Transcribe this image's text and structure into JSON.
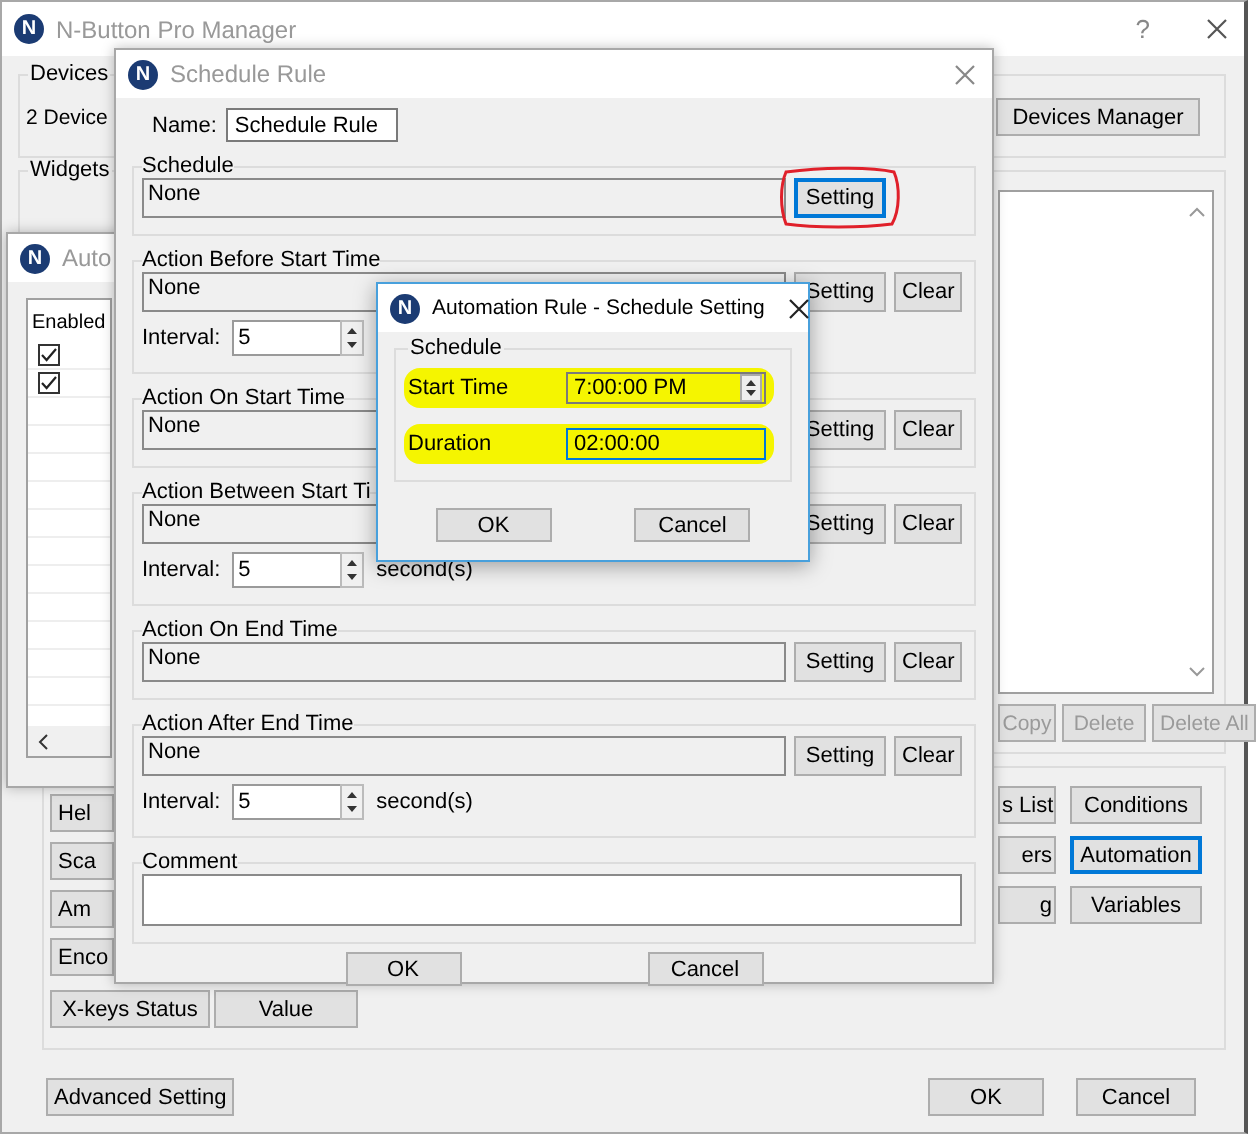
{
  "main_window": {
    "logo": "N",
    "title": "N-Button Pro Manager",
    "help": "?",
    "devices": {
      "label": "Devices",
      "count": "2 Device",
      "button": "Devices Manager"
    },
    "widgets": {
      "label": "Widgets",
      "buttons": [
        {
          "label": "Copy",
          "disabled": true
        },
        {
          "label": "Delete",
          "disabled": true
        },
        {
          "label": "Delete All",
          "disabled": true
        }
      ]
    },
    "left_buttons": [
      {
        "label": "Hel"
      },
      {
        "label": "Sca"
      },
      {
        "label": "Am"
      },
      {
        "label": "Enco"
      }
    ],
    "bottom_buttons": [
      {
        "label": "X-keys Status"
      },
      {
        "label": "Value"
      }
    ],
    "middle_buttons": [
      {
        "label": "s List"
      },
      {
        "label": "ers"
      },
      {
        "label": "g"
      }
    ],
    "side_buttons": [
      {
        "label": "Conditions",
        "focused": false
      },
      {
        "label": "Automation",
        "focused": true
      },
      {
        "label": "Variables",
        "focused": false
      }
    ],
    "advanced_button": "Advanced Setting",
    "ok_button": "OK",
    "cancel_button": "Cancel"
  },
  "automation_window": {
    "logo": "N",
    "title": "Auto",
    "column": "Enabled",
    "rows": [
      {
        "checked": true
      },
      {
        "checked": true
      }
    ]
  },
  "schedule_rule": {
    "logo": "N",
    "title": "Schedule Rule",
    "name_label": "Name:",
    "name_value": "Schedule Rule",
    "groups": [
      {
        "label": "Schedule",
        "value": "None",
        "setting": "Setting",
        "focused": true,
        "circled": true
      },
      {
        "label": "Action Before Start Time",
        "value": "None",
        "setting": "Setting",
        "clear": "Clear",
        "focused": false,
        "circled": false,
        "interval": {
          "label": "Interval:",
          "value": "5"
        }
      },
      {
        "label": "Action On Start Time",
        "value": "None",
        "setting": "Setting",
        "clear": "Clear",
        "focused": false,
        "circled": false
      },
      {
        "label": "Action Between Start Ti",
        "value": "None",
        "setting": "Setting",
        "clear": "Clear",
        "focused": false,
        "circled": false,
        "interval": {
          "label": "Interval:",
          "value": "5",
          "unit": "second(s)"
        }
      },
      {
        "label": "Action On End Time",
        "value": "None",
        "setting": "Setting",
        "clear": "Clear",
        "focused": false,
        "circled": false
      },
      {
        "label": "Action After End Time",
        "value": "None",
        "setting": "Setting",
        "clear": "Clear",
        "focused": false,
        "circled": false,
        "interval": {
          "label": "Interval:",
          "value": "5",
          "unit": "second(s)"
        }
      }
    ],
    "comment_label": "Comment",
    "ok": "OK",
    "cancel": "Cancel"
  },
  "schedule_setting": {
    "logo": "N",
    "title": "Automation Rule - Schedule Setting",
    "group": "Schedule",
    "fields": [
      {
        "kind": "spinner",
        "label": "Start Time",
        "value": "7:00:00 PM",
        "highlighted": true,
        "focused": false
      },
      {
        "kind": "text",
        "label": "Duration",
        "value": "02:00:00",
        "highlighted": true,
        "focused": true
      }
    ],
    "ok": "OK",
    "cancel": "Cancel"
  }
}
